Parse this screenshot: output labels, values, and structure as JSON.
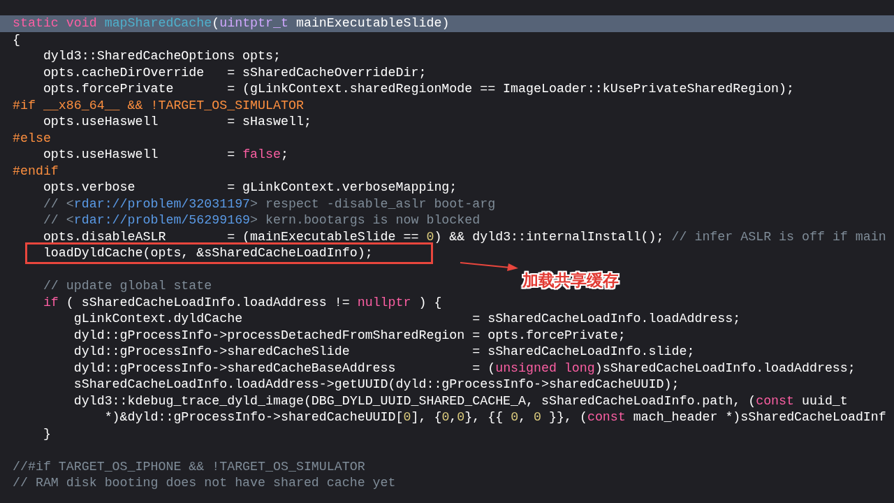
{
  "code_lines": [
    {
      "selected": true,
      "boxed": false,
      "tokens": [
        {
          "kind": "keyword",
          "text": "static void "
        },
        {
          "kind": "function",
          "text": "mapSharedCache"
        },
        {
          "kind": "plain",
          "text": "("
        },
        {
          "kind": "type",
          "text": "uintptr_t"
        },
        {
          "kind": "plain",
          "text": " mainExecutableSlide)"
        }
      ]
    },
    {
      "selected": false,
      "boxed": false,
      "tokens": [
        {
          "kind": "plain",
          "text": "{"
        }
      ]
    },
    {
      "selected": false,
      "boxed": false,
      "tokens": [
        {
          "kind": "plain",
          "text": "    dyld3::SharedCacheOptions opts;"
        }
      ]
    },
    {
      "selected": false,
      "boxed": false,
      "tokens": [
        {
          "kind": "plain",
          "text": "    opts.cacheDirOverride   = sSharedCacheOverrideDir;"
        }
      ]
    },
    {
      "selected": false,
      "boxed": false,
      "tokens": [
        {
          "kind": "plain",
          "text": "    opts.forcePrivate       = (gLinkContext.sharedRegionMode == ImageLoader::kUsePrivateSharedRegion);"
        }
      ]
    },
    {
      "selected": false,
      "boxed": false,
      "tokens": [
        {
          "kind": "preprocessor",
          "text": "#if __x86_64__ && !TARGET_OS_SIMULATOR"
        }
      ]
    },
    {
      "selected": false,
      "boxed": false,
      "tokens": [
        {
          "kind": "plain",
          "text": "    opts.useHaswell         = sHaswell;"
        }
      ]
    },
    {
      "selected": false,
      "boxed": false,
      "tokens": [
        {
          "kind": "preprocessor",
          "text": "#else"
        }
      ]
    },
    {
      "selected": false,
      "boxed": false,
      "tokens": [
        {
          "kind": "plain",
          "text": "    opts.useHaswell         = "
        },
        {
          "kind": "keyword",
          "text": "false"
        },
        {
          "kind": "plain",
          "text": ";"
        }
      ]
    },
    {
      "selected": false,
      "boxed": false,
      "tokens": [
        {
          "kind": "preprocessor",
          "text": "#endif"
        }
      ]
    },
    {
      "selected": false,
      "boxed": false,
      "tokens": [
        {
          "kind": "plain",
          "text": "    opts.verbose            = gLinkContext.verboseMapping;"
        }
      ]
    },
    {
      "selected": false,
      "boxed": false,
      "tokens": [
        {
          "kind": "comment",
          "text": "    // <"
        },
        {
          "kind": "link",
          "text": "rdar://problem/32031197"
        },
        {
          "kind": "comment",
          "text": "> respect -disable_aslr boot-arg"
        }
      ]
    },
    {
      "selected": false,
      "boxed": false,
      "tokens": [
        {
          "kind": "comment",
          "text": "    // <"
        },
        {
          "kind": "link",
          "text": "rdar://problem/56299169"
        },
        {
          "kind": "comment",
          "text": "> kern.bootargs is now blocked"
        }
      ]
    },
    {
      "selected": false,
      "boxed": false,
      "tokens": [
        {
          "kind": "plain",
          "text": "    opts.disableASLR        = (mainExecutableSlide == "
        },
        {
          "kind": "number",
          "text": "0"
        },
        {
          "kind": "plain",
          "text": ") && dyld3::internalInstall(); "
        },
        {
          "kind": "comment",
          "text": "// infer ASLR is off if main"
        }
      ]
    },
    {
      "selected": false,
      "boxed": true,
      "tokens": [
        {
          "kind": "plain",
          "text": "    loadDyldCache(opts, &sSharedCacheLoadInfo);"
        }
      ]
    },
    {
      "selected": false,
      "boxed": false
    },
    {
      "selected": false,
      "boxed": false,
      "tokens": [
        {
          "kind": "comment",
          "text": "    // update global state"
        }
      ]
    },
    {
      "selected": false,
      "boxed": false,
      "tokens": [
        {
          "kind": "keyword",
          "text": "    if"
        },
        {
          "kind": "plain",
          "text": " ( sSharedCacheLoadInfo.loadAddress != "
        },
        {
          "kind": "keyword",
          "text": "nullptr"
        },
        {
          "kind": "plain",
          "text": " ) {"
        }
      ]
    },
    {
      "selected": false,
      "boxed": false,
      "tokens": [
        {
          "kind": "plain",
          "text": "        gLinkContext.dyldCache                              = sSharedCacheLoadInfo.loadAddress;"
        }
      ]
    },
    {
      "selected": false,
      "boxed": false,
      "tokens": [
        {
          "kind": "plain",
          "text": "        dyld::gProcessInfo->processDetachedFromSharedRegion = opts.forcePrivate;"
        }
      ]
    },
    {
      "selected": false,
      "boxed": false,
      "tokens": [
        {
          "kind": "plain",
          "text": "        dyld::gProcessInfo->sharedCacheSlide                = sSharedCacheLoadInfo.slide;"
        }
      ]
    },
    {
      "selected": false,
      "boxed": false,
      "tokens": [
        {
          "kind": "plain",
          "text": "        dyld::gProcessInfo->sharedCacheBaseAddress          = ("
        },
        {
          "kind": "keyword",
          "text": "unsigned long"
        },
        {
          "kind": "plain",
          "text": ")sSharedCacheLoadInfo.loadAddress;"
        }
      ]
    },
    {
      "selected": false,
      "boxed": false,
      "tokens": [
        {
          "kind": "plain",
          "text": "        sSharedCacheLoadInfo.loadAddress->getUUID(dyld::gProcessInfo->sharedCacheUUID);"
        }
      ]
    },
    {
      "selected": false,
      "boxed": false,
      "tokens": [
        {
          "kind": "plain",
          "text": "        dyld3::kdebug_trace_dyld_image(DBG_DYLD_UUID_SHARED_CACHE_A, sSharedCacheLoadInfo.path, ("
        },
        {
          "kind": "keyword",
          "text": "const"
        },
        {
          "kind": "plain",
          "text": " uuid_t"
        }
      ]
    },
    {
      "selected": false,
      "boxed": false,
      "tokens": [
        {
          "kind": "plain",
          "text": "            *)&dyld::gProcessInfo->sharedCacheUUID["
        },
        {
          "kind": "number",
          "text": "0"
        },
        {
          "kind": "plain",
          "text": "], {"
        },
        {
          "kind": "number",
          "text": "0"
        },
        {
          "kind": "plain",
          "text": ","
        },
        {
          "kind": "number",
          "text": "0"
        },
        {
          "kind": "plain",
          "text": "}, {{ "
        },
        {
          "kind": "number",
          "text": "0"
        },
        {
          "kind": "plain",
          "text": ", "
        },
        {
          "kind": "number",
          "text": "0"
        },
        {
          "kind": "plain",
          "text": " }}, ("
        },
        {
          "kind": "keyword",
          "text": "const"
        },
        {
          "kind": "plain",
          "text": " mach_header *)sSharedCacheLoadInf"
        }
      ]
    },
    {
      "selected": false,
      "boxed": false,
      "tokens": [
        {
          "kind": "plain",
          "text": "    }"
        }
      ]
    },
    {
      "selected": false,
      "boxed": false
    },
    {
      "selected": false,
      "boxed": false,
      "tokens": [
        {
          "kind": "comment",
          "text": "//#if TARGET_OS_IPHONE && !TARGET_OS_SIMULATOR"
        }
      ]
    },
    {
      "selected": false,
      "boxed": false,
      "tokens": [
        {
          "kind": "comment",
          "text": "// RAM disk booting does not have shared cache yet"
        }
      ]
    }
  ],
  "annotation": {
    "label": "加载共享缓存"
  }
}
